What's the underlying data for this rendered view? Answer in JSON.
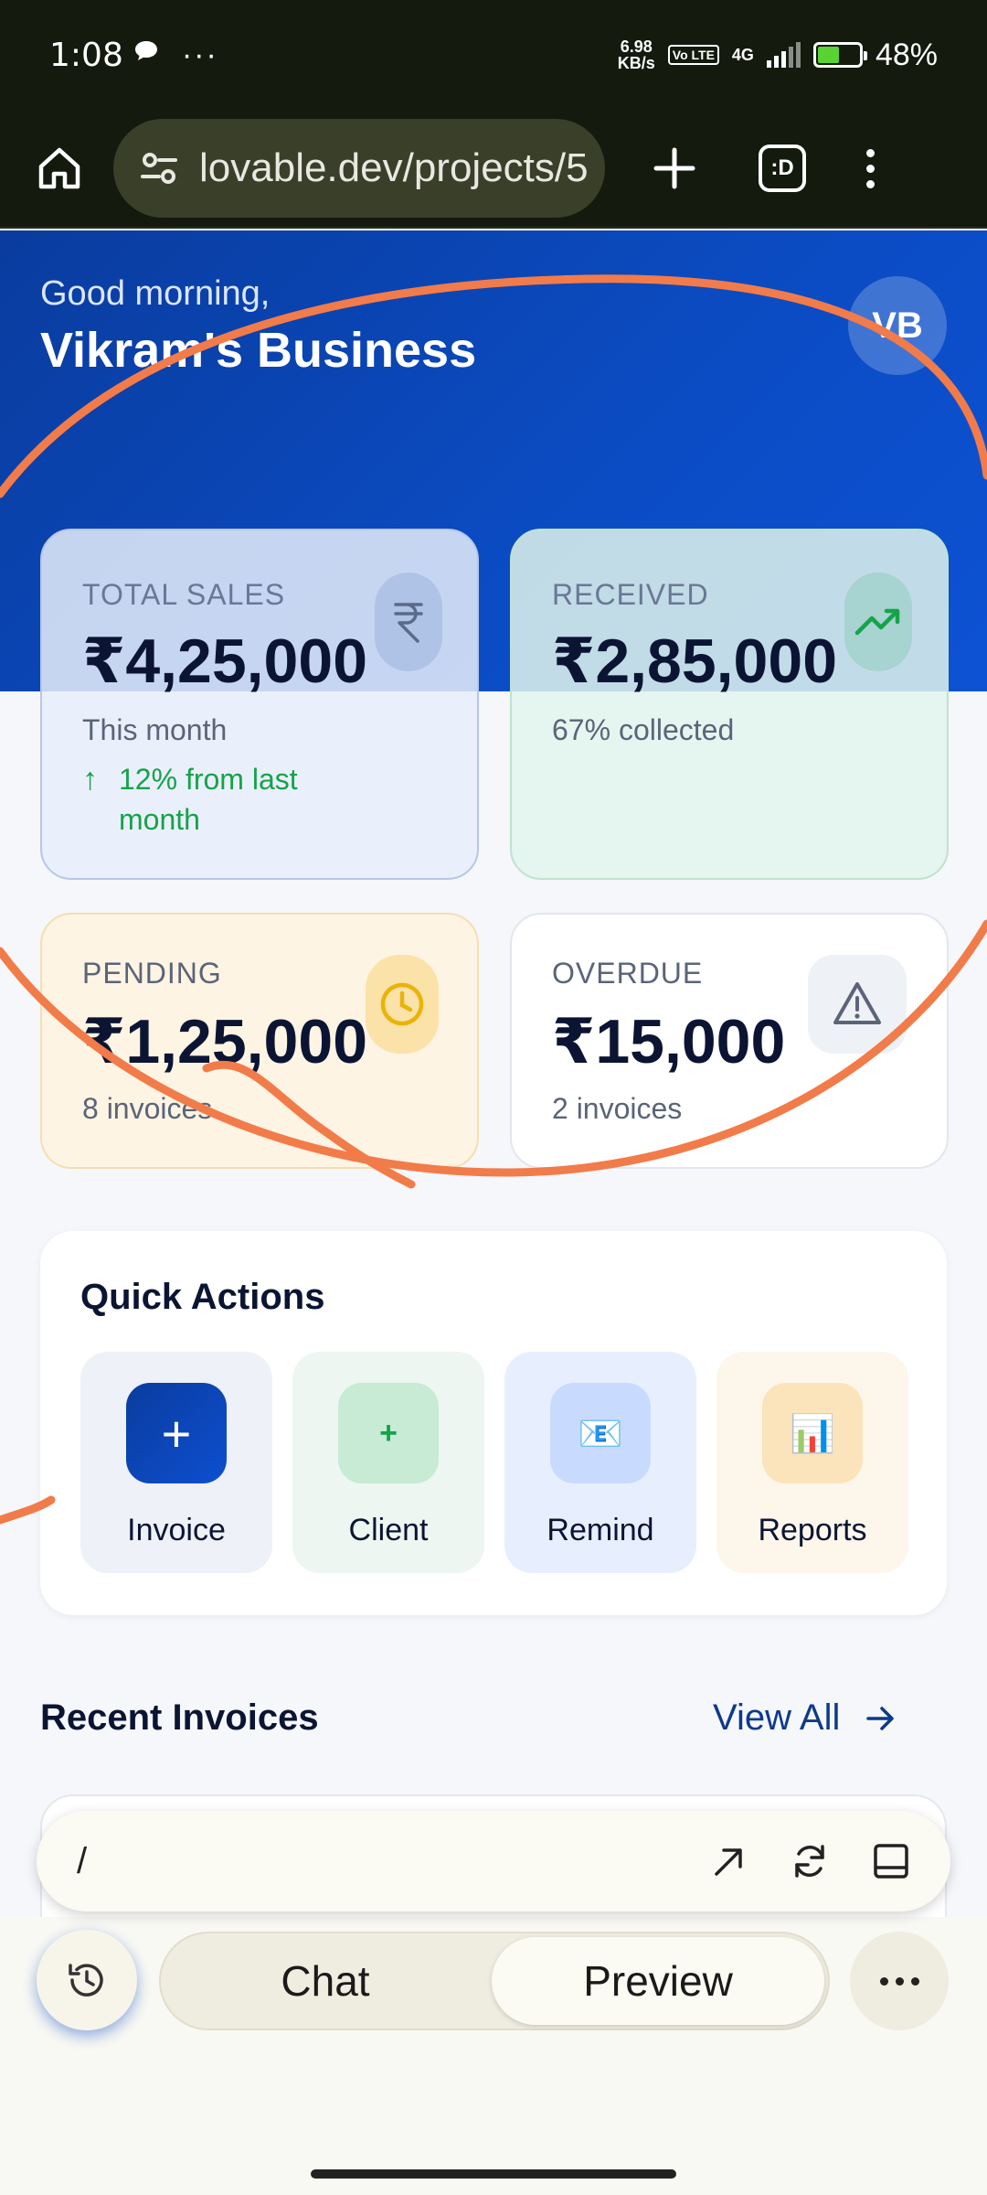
{
  "status_bar": {
    "time": "1:08",
    "dots": "···",
    "net_speed_value": "6.98",
    "net_speed_unit": "KB/s",
    "volte": "Vo LTE",
    "network": "4G",
    "battery": "48%",
    "battery_level": 0.48
  },
  "browser": {
    "url": "lovable.dev/projects/5",
    "tab_count": ":D"
  },
  "header": {
    "greeting": "Good morning,",
    "business_name": "Vikram's Business",
    "avatar_initials": "VB"
  },
  "stats": {
    "total_sales": {
      "label": "TOTAL SALES",
      "value": "₹4,25,000",
      "sub": "This month",
      "trend": "12% from last month",
      "icon": "rupee-icon"
    },
    "received": {
      "label": "RECEIVED",
      "value": "₹2,85,000",
      "sub": "67% collected",
      "icon": "trending-up-icon"
    },
    "pending": {
      "label": "PENDING",
      "value": "₹1,25,000",
      "sub": "8 invoices",
      "icon": "clock-icon"
    },
    "overdue": {
      "label": "OVERDUE",
      "value": "₹15,000",
      "sub": "2 invoices",
      "icon": "warning-icon"
    }
  },
  "quick_actions": {
    "title": "Quick Actions",
    "items": [
      {
        "label": "Invoice",
        "glyph": "+"
      },
      {
        "label": "Client",
        "glyph": "+"
      },
      {
        "label": "Remind",
        "glyph": "📧"
      },
      {
        "label": "Reports",
        "glyph": "📊"
      }
    ]
  },
  "recent": {
    "title": "Recent Invoices",
    "view_all": "View All"
  },
  "prompt": {
    "value": "/"
  },
  "bottom_nav": {
    "chat": "Chat",
    "preview": "Preview"
  },
  "colors": {
    "hero": "#0b4cc4",
    "success": "#16a34a",
    "scribble": "#f27b4a"
  }
}
